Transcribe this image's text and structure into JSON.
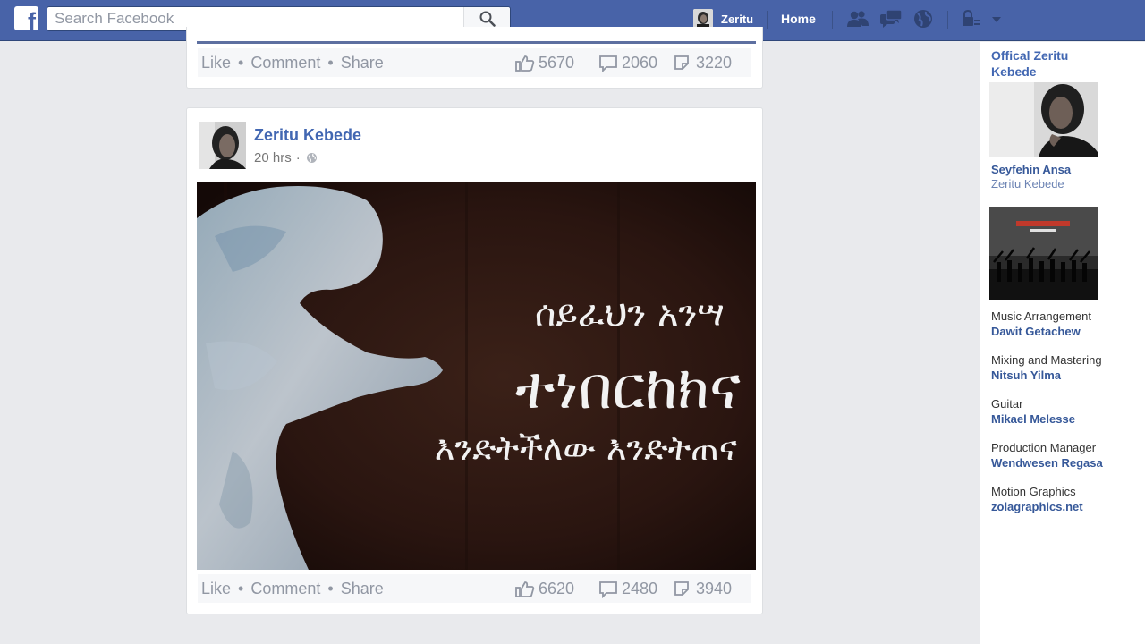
{
  "topbar": {
    "logo_letter": "f",
    "search_placeholder": "Search Facebook",
    "user_name": "Zeritu",
    "home_label": "Home",
    "icons": [
      "search-icon",
      "friend-requests-icon",
      "messages-icon",
      "notifications-globe-icon",
      "privacy-lock-icon",
      "account-menu-caret-icon"
    ],
    "bar_color": "#4863a8"
  },
  "previous_post": {
    "actions": {
      "like": "Like",
      "comment": "Comment",
      "share": "Share",
      "separator": "•"
    },
    "stats": {
      "likes": "5670",
      "comments": "2060",
      "shares": "3220"
    }
  },
  "post": {
    "author": "Zeritu Kebede",
    "time": "20 hrs",
    "time_separator": "·",
    "image_text": {
      "line1": "ሰይፈህን አንሣ",
      "line2": "ተነበርከክና",
      "line3": "እንድትችለው እንድትጠና"
    },
    "actions": {
      "like": "Like",
      "comment": "Comment",
      "share": "Share",
      "separator": "•"
    },
    "stats": {
      "likes": "6620",
      "comments": "2480",
      "shares": "3940"
    }
  },
  "sidebar": {
    "title": "Offical Zeritu Kebede",
    "featured_name": "Seyfehin Ansa",
    "featured_artist": "Zeritu Kebede",
    "credits": [
      {
        "role": "Music Arrangement",
        "name": "Dawit Getachew"
      },
      {
        "role": "Mixing and Mastering",
        "name": "Nitsuh Yilma"
      },
      {
        "role": "Guitar",
        "name": "Mikael Melesse"
      },
      {
        "role": "Production Manager",
        "name": "Wendwesen Regasa"
      },
      {
        "role": "Motion Graphics",
        "name": "zolagraphics.net"
      }
    ]
  },
  "colors": {
    "link": "#4267b2",
    "muted": "#9197a3",
    "background": "#e9eaed"
  }
}
